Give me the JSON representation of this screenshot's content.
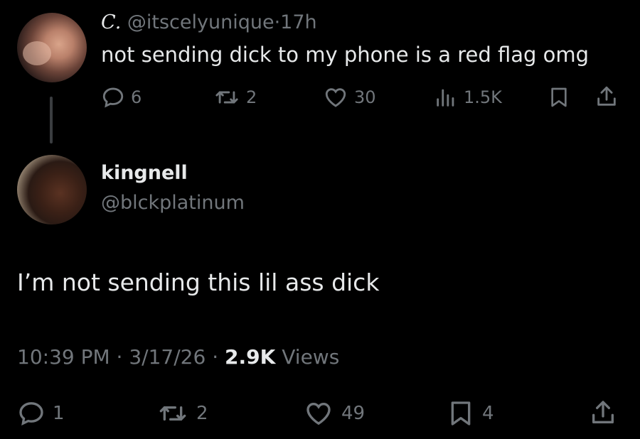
{
  "parent_tweet": {
    "display_name": "C.",
    "handle": "@itscelyunique",
    "separator": "·",
    "time": "17h",
    "text": "not sending dick to my phone is a red flag omg",
    "replies": "6",
    "reposts": "2",
    "likes": "30",
    "views": "1.5K"
  },
  "reply_tweet": {
    "display_name": "kingnell",
    "handle": "@blckplatinum",
    "text": "I’m not sending this lil ass dick",
    "time": "10:39 PM",
    "date": "3/17/26",
    "dot": "·",
    "views_count": "2.9K",
    "views_label": "Views",
    "replies": "1",
    "reposts": "2",
    "likes": "49",
    "bookmarks": "4"
  },
  "colors": {
    "background": "#000000",
    "text": "#e7e9ea",
    "muted": "#71767b"
  },
  "icons": [
    "reply-icon",
    "repost-icon",
    "like-icon",
    "views-icon",
    "bookmark-icon",
    "share-icon"
  ]
}
